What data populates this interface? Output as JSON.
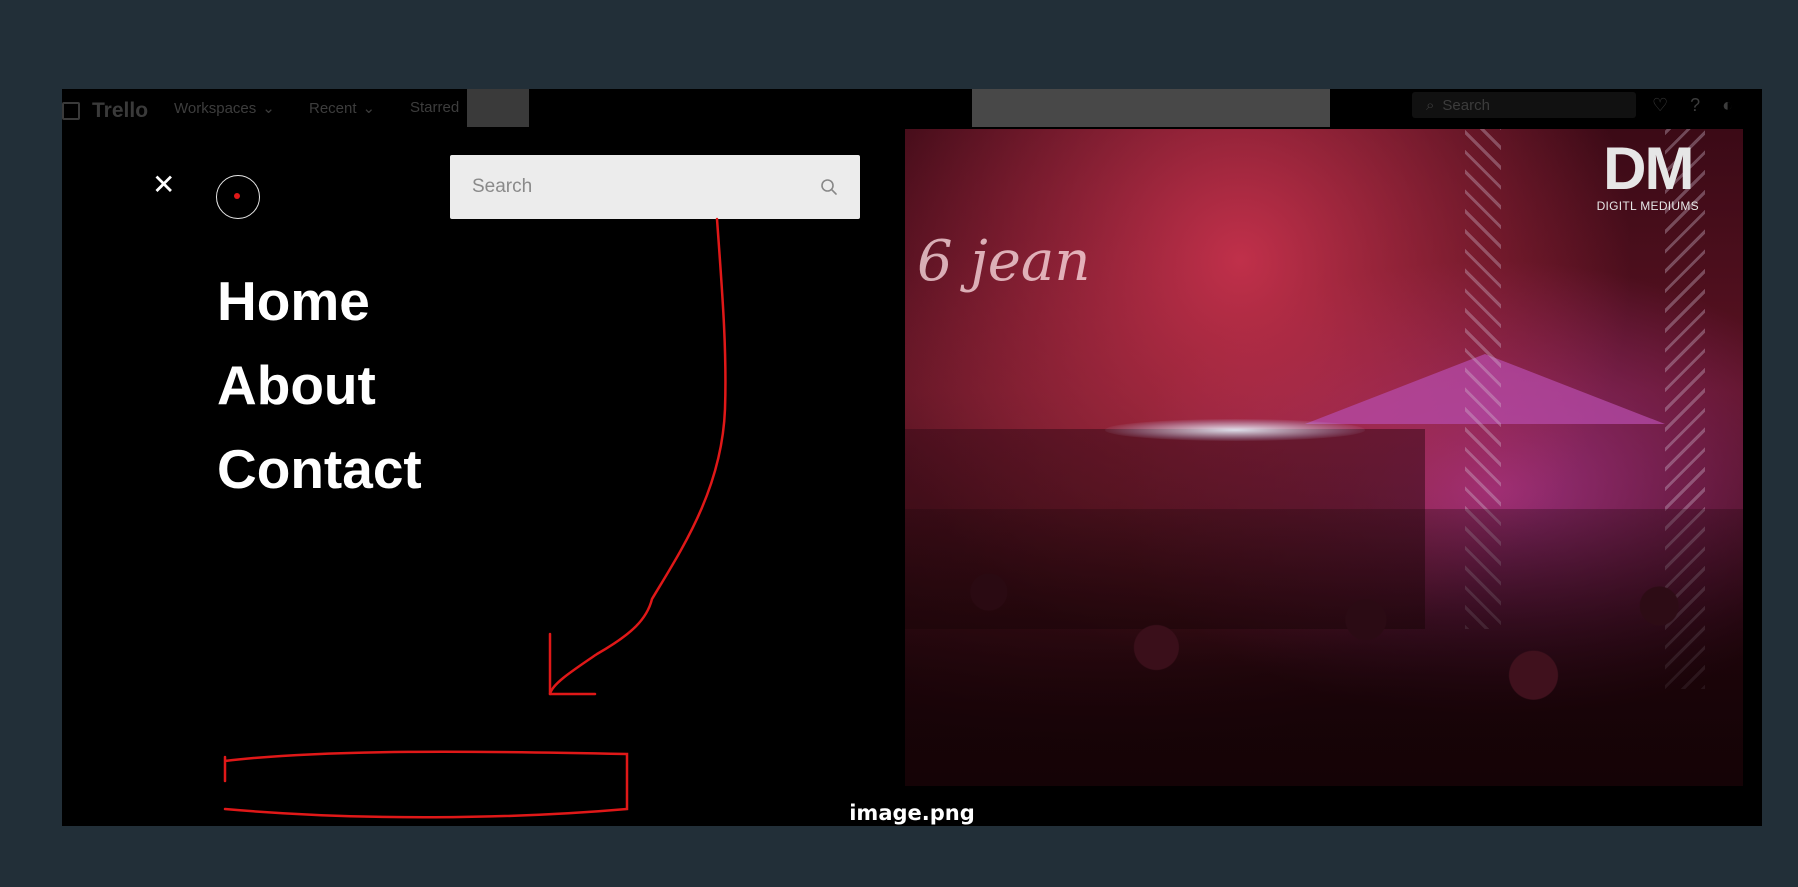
{
  "topbar": {
    "app_name": "Trello",
    "workspaces": "Workspaces",
    "recent": "Recent",
    "starred": "Starred",
    "search_placeholder": "Search",
    "icons": [
      "bell-icon",
      "help-icon",
      "theme-toggle-icon"
    ]
  },
  "menu": {
    "close_label": "✕",
    "search_placeholder": "Search",
    "nav": [
      "Home",
      "About",
      "Contact"
    ]
  },
  "photo": {
    "script_text": "6 jean",
    "watermark_big": "DM",
    "watermark_small": "DIGITL MEDIUMS"
  },
  "caption": "image.png",
  "colors": {
    "page_bg": "#222f38",
    "panel_bg": "#000000",
    "annotation": "#e01818",
    "accent_dot": "#e01818"
  }
}
